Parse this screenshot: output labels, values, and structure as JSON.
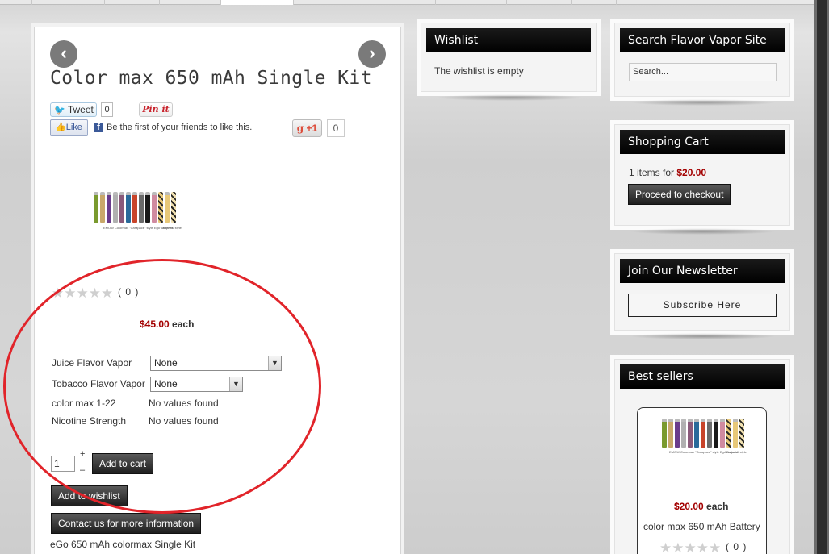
{
  "product": {
    "title": "Color max 650 mAh Single Kit",
    "prev_arrow": "‹",
    "next_arrow": "›",
    "social": {
      "tweet_label": "Tweet",
      "tweet_count": "0",
      "pin_label": "Pin it",
      "like_label": "Like",
      "facebook_text": "Be the first of your friends to like this.",
      "gplus_label": "+1",
      "gplus_count": "0"
    },
    "image_caption_left": "EMOW Colormax \"Carapace\" style Ego Batteries",
    "image_caption_right": "\"Leopard\" style",
    "rating_count": "( 0 )",
    "price": "$45.00",
    "price_unit": "each",
    "options": [
      {
        "label": "Juice Flavor Vapor",
        "value": "None"
      },
      {
        "label": "Tobacco Flavor Vapor",
        "value": "None"
      },
      {
        "label": "color max 1-22",
        "value": "No values found"
      },
      {
        "label": "Nicotine Strength",
        "value": "No values found"
      }
    ],
    "quantity": "1",
    "qty_plus": "+",
    "qty_minus": "–",
    "add_to_cart": "Add to cart",
    "add_to_wishlist": "Add to wishlist",
    "contact": "Contact us for more information",
    "description": "eGo 650 mAh colormax Single Kit"
  },
  "wishlist": {
    "title": "Wishlist",
    "text": "The wishlist is empty"
  },
  "search": {
    "title": "Search Flavor Vapor Site",
    "placeholder": "Search..."
  },
  "cart": {
    "title": "Shopping Cart",
    "items_text": "1 items for",
    "total": "$20.00",
    "checkout": "Proceed to checkout"
  },
  "newsletter": {
    "title": "Join Our Newsletter",
    "button": "Subscribe Here"
  },
  "bestsellers": {
    "title": "Best sellers",
    "price": "$20.00",
    "price_unit": "each",
    "name": "color max 650 mAh Battery",
    "rating_count": "( 0 )"
  },
  "colors": {
    "price_red": "#a30000",
    "highlight_ellipse": "#e1242a",
    "widget_header": "#000000",
    "batteries": [
      "#7a9a2e",
      "#c9a86a",
      "#6a3c8c",
      "#b0b0b0",
      "#8a5a7a",
      "#2a6a9a",
      "#c8442a",
      "#6a6a6a",
      "#1a1a1a",
      "#d08aa0",
      "#e0e0e0",
      "#e8c878",
      "#2a2a2a"
    ]
  }
}
